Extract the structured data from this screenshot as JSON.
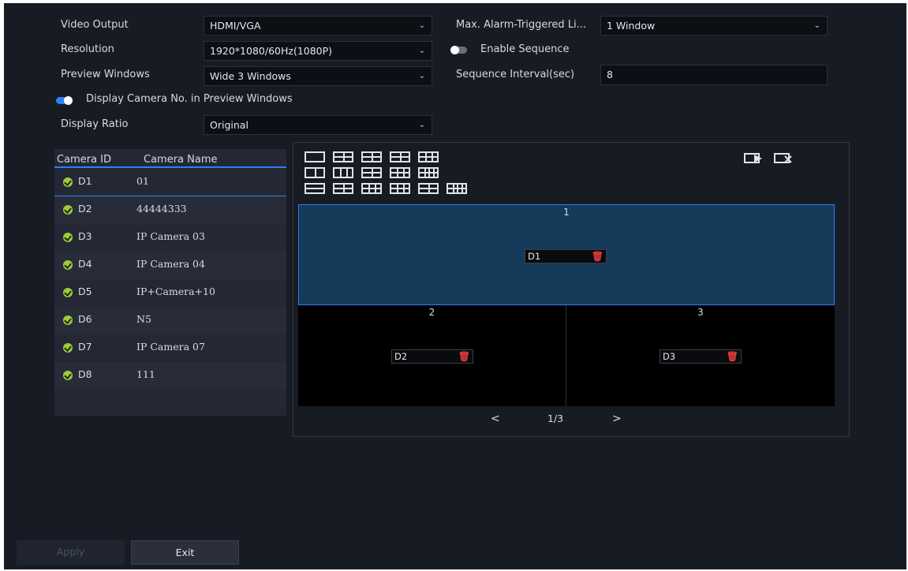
{
  "settings": {
    "video_output": {
      "label": "Video Output",
      "value": "HDMI/VGA"
    },
    "resolution": {
      "label": "Resolution",
      "value": "1920*1080/60Hz(1080P)"
    },
    "preview_windows": {
      "label": "Preview Windows",
      "value": "Wide 3 Windows"
    },
    "display_camera_no": {
      "label": "Display Camera No. in Preview Windows",
      "enabled": true
    },
    "display_ratio": {
      "label": "Display Ratio",
      "value": "Original"
    },
    "max_alarm": {
      "label": "Max. Alarm-Triggered Li...",
      "value": "1 Window"
    },
    "enable_sequence": {
      "label": "Enable Sequence",
      "enabled": false
    },
    "sequence_interval": {
      "label": "Sequence Interval(sec)",
      "value": "8"
    }
  },
  "camera_table": {
    "headers": [
      "Camera ID",
      "Camera Name"
    ],
    "rows": [
      {
        "id": "D1",
        "name": "01",
        "selected": true
      },
      {
        "id": "D2",
        "name": "44444333"
      },
      {
        "id": "D3",
        "name": "IP Camera 03"
      },
      {
        "id": "D4",
        "name": "IP Camera 04"
      },
      {
        "id": "D5",
        "name": "IP+Camera+10"
      },
      {
        "id": "D6",
        "name": "N5"
      },
      {
        "id": "D7",
        "name": "IP Camera 07"
      },
      {
        "id": "D8",
        "name": "111"
      }
    ]
  },
  "preview": {
    "windows": [
      {
        "number": "1",
        "camera": "D1",
        "selected": true
      },
      {
        "number": "2",
        "camera": "D2"
      },
      {
        "number": "3",
        "camera": "D3"
      }
    ],
    "pagination": {
      "prev": "<",
      "page": "1/3",
      "next": ">"
    },
    "icons": [
      "start-sequence-icon",
      "stop-sequence-icon",
      "trash-icon",
      "chevron-down-icon",
      "check-icon"
    ]
  },
  "actions": {
    "apply": "Apply",
    "exit": "Exit"
  },
  "colors": {
    "background": "#171b23",
    "accent": "#2f7ff0",
    "selected_window": "#153a5a",
    "status_ok": "#9ecb3c",
    "delete": "#e23b3b"
  }
}
